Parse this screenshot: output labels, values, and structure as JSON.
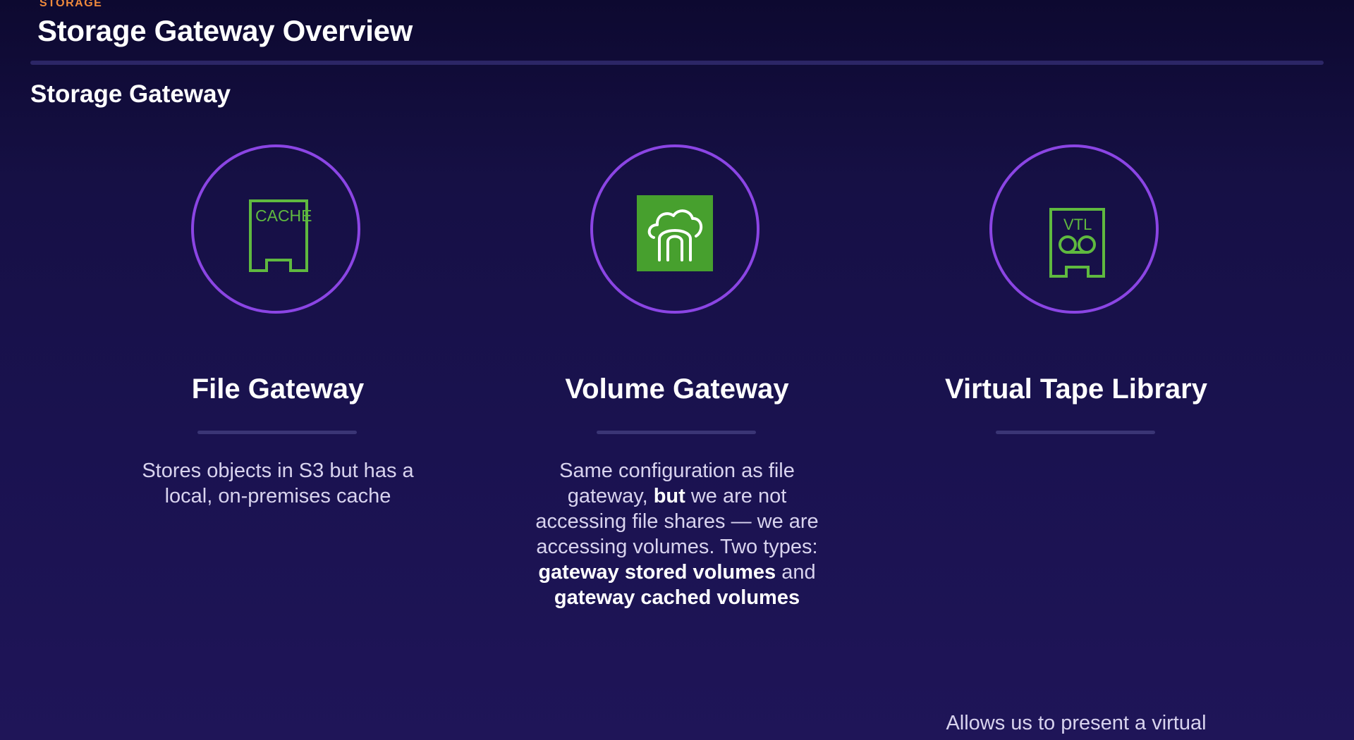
{
  "header": {
    "eyebrow": "STORAGE",
    "title": "Storage Gateway Overview"
  },
  "section": {
    "title": "Storage Gateway"
  },
  "colors": {
    "accent_orange": "#f08a3c",
    "circle_purple": "#8b45e4",
    "icon_green": "#5fb93f",
    "background_dark": "#0d0930"
  },
  "cards": [
    {
      "icon": "file-gateway-cache-icon",
      "icon_text": "CACHE",
      "title": "File Gateway",
      "desc": {
        "p1": "Stores objects in S3 but has a local, on-premises cache"
      }
    },
    {
      "icon": "volume-gateway-cloud-icon",
      "title": "Volume Gateway",
      "desc": {
        "p1": "Same configuration as file gateway,",
        "p2": "but",
        "p3": "we are not accessing file shares — we are accessing volumes. Two types:",
        "p4": "gateway stored volumes",
        "p5": "and",
        "p6": "gateway cached volumes"
      }
    },
    {
      "icon": "virtual-tape-library-icon",
      "icon_text": "VTL",
      "title": "Virtual Tape Library",
      "desc": {
        "p1": "Allows us to present a virtual"
      }
    }
  ]
}
